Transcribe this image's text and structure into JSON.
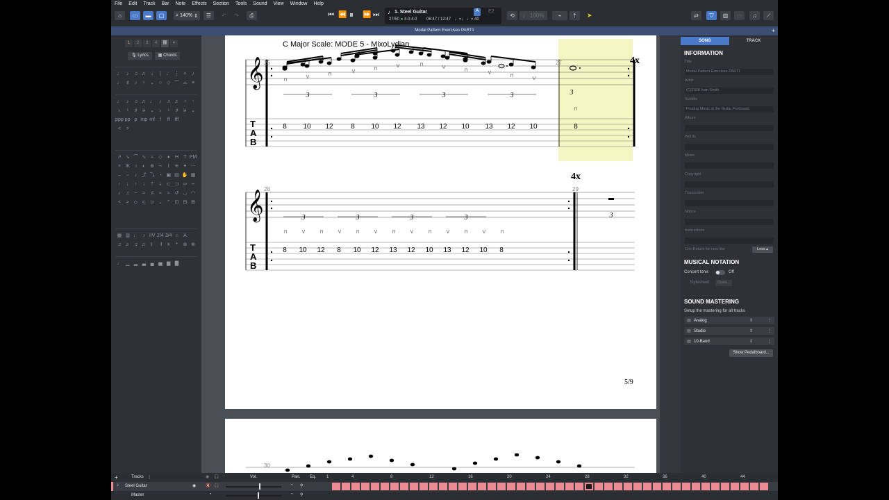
{
  "menu": [
    "File",
    "Edit",
    "Track",
    "Bar",
    "Note",
    "Effects",
    "Section",
    "Tools",
    "Sound",
    "View",
    "Window",
    "Help"
  ],
  "toolbar": {
    "zoom": "140%"
  },
  "lcd": {
    "track_name": "1. Steel Guitar",
    "bar_position": "27/50",
    "time_sig": "4.0:4.0",
    "time": "06:47 / 12:47",
    "tempo": "♩=♩ ♩= 40",
    "btn_a": "A",
    "btn_e2": "E2"
  },
  "document_title": "Modal Pattern Exercises PART1",
  "left_panel": {
    "tabs": [
      "1",
      "2",
      "3",
      "4"
    ],
    "lyrics_label": "Lyrics",
    "chords_label": "Chords"
  },
  "score": {
    "title": "C Major Scale: MODE 5 - MixoLydian",
    "bar_26": "26",
    "bar_27": "27",
    "bar_28": "28",
    "bar_29": "29",
    "bar_30": "30",
    "repeat_4x": "4x",
    "triplet": "3",
    "tab_letters": [
      "T",
      "A",
      "B"
    ],
    "sys1_tab": [
      "8",
      "10",
      "12",
      "8",
      "10",
      "12",
      "13",
      "12",
      "10",
      "13",
      "12",
      "10"
    ],
    "sys1_bar27_tab": "8",
    "sys2_tab": [
      "8",
      "10",
      "12",
      "8",
      "10",
      "12",
      "13",
      "12",
      "10",
      "13",
      "12",
      "10",
      "8"
    ],
    "page_num": "5/9"
  },
  "right_panel": {
    "tab_song": "SONG",
    "tab_track": "TRACK",
    "information": "INFORMATION",
    "fields": [
      {
        "label": "Title",
        "value": "Modal Pattern Exercises PART1"
      },
      {
        "label": "Artist",
        "value": "(C)2028 Ivan Smith"
      },
      {
        "label": "Subtitle",
        "value": "Finding Music in the Guitar Fretboard"
      },
      {
        "label": "Album",
        "value": ""
      },
      {
        "label": "Words",
        "value": ""
      },
      {
        "label": "Music",
        "value": ""
      },
      {
        "label": "Copyright",
        "value": ""
      },
      {
        "label": "Transcriber",
        "value": ""
      },
      {
        "label": "Notice",
        "value": ""
      },
      {
        "label": "Instructions",
        "value": ""
      }
    ],
    "newline_hint": "Ctrl+Return for new line",
    "less_btn": "Less",
    "musical_notation": "MUSICAL NOTATION",
    "concert_tone": "Concert tone:",
    "concert_tone_state": "Off",
    "stylesheet": "Stylesheet:",
    "stylesheet_btn": "Open...",
    "sound_mastering": "SOUND MASTERING",
    "mastering_hint": "Setup the mastering for all tracks",
    "mastering_items": [
      "Analog",
      "Studio",
      "10-Band"
    ],
    "pedalboard_btn": "Show Pedalboard..."
  },
  "tracks": {
    "header": "Tracks",
    "vol": "Vol.",
    "pan": "Pan.",
    "eq": "Eq.",
    "ruler": [
      "1",
      "4",
      "8",
      "12",
      "16",
      "20",
      "24",
      "28",
      "32",
      "36",
      "40",
      "44"
    ],
    "guitar": "Steel Guitar",
    "master": "Master"
  },
  "colors": {
    "accent": "#4a79c9",
    "bar_fill": "#e98b91",
    "highlight": "#f4f7c4"
  }
}
